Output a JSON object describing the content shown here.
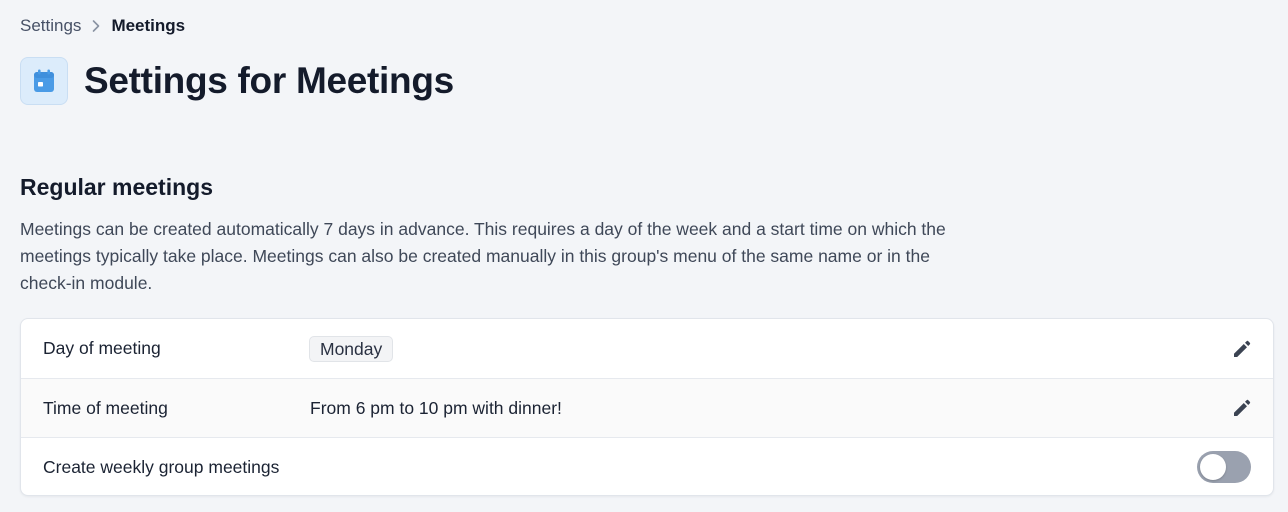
{
  "breadcrumb": {
    "parent_label": "Settings",
    "current_label": "Meetings"
  },
  "header": {
    "title": "Settings for Meetings",
    "icon": "calendar-icon"
  },
  "section": {
    "title": "Regular meetings",
    "description": "Meetings can be created automatically 7 days in advance. This requires a day of the week and a start time on which the meetings typically take place. Meetings can also be created manually in this group's menu of the same name or in the check-in module."
  },
  "settings": {
    "day": {
      "label": "Day of meeting",
      "value": "Monday",
      "action_icon": "pencil-icon"
    },
    "time": {
      "label": "Time of meeting",
      "value": "From 6 pm to 10 pm with dinner!",
      "action_icon": "pencil-icon"
    },
    "weekly": {
      "label": "Create weekly group meetings",
      "enabled": false
    }
  },
  "colors": {
    "background": "#f3f5f8",
    "icon_accent": "#4a9be6",
    "toggle_off": "#9aa1af"
  }
}
